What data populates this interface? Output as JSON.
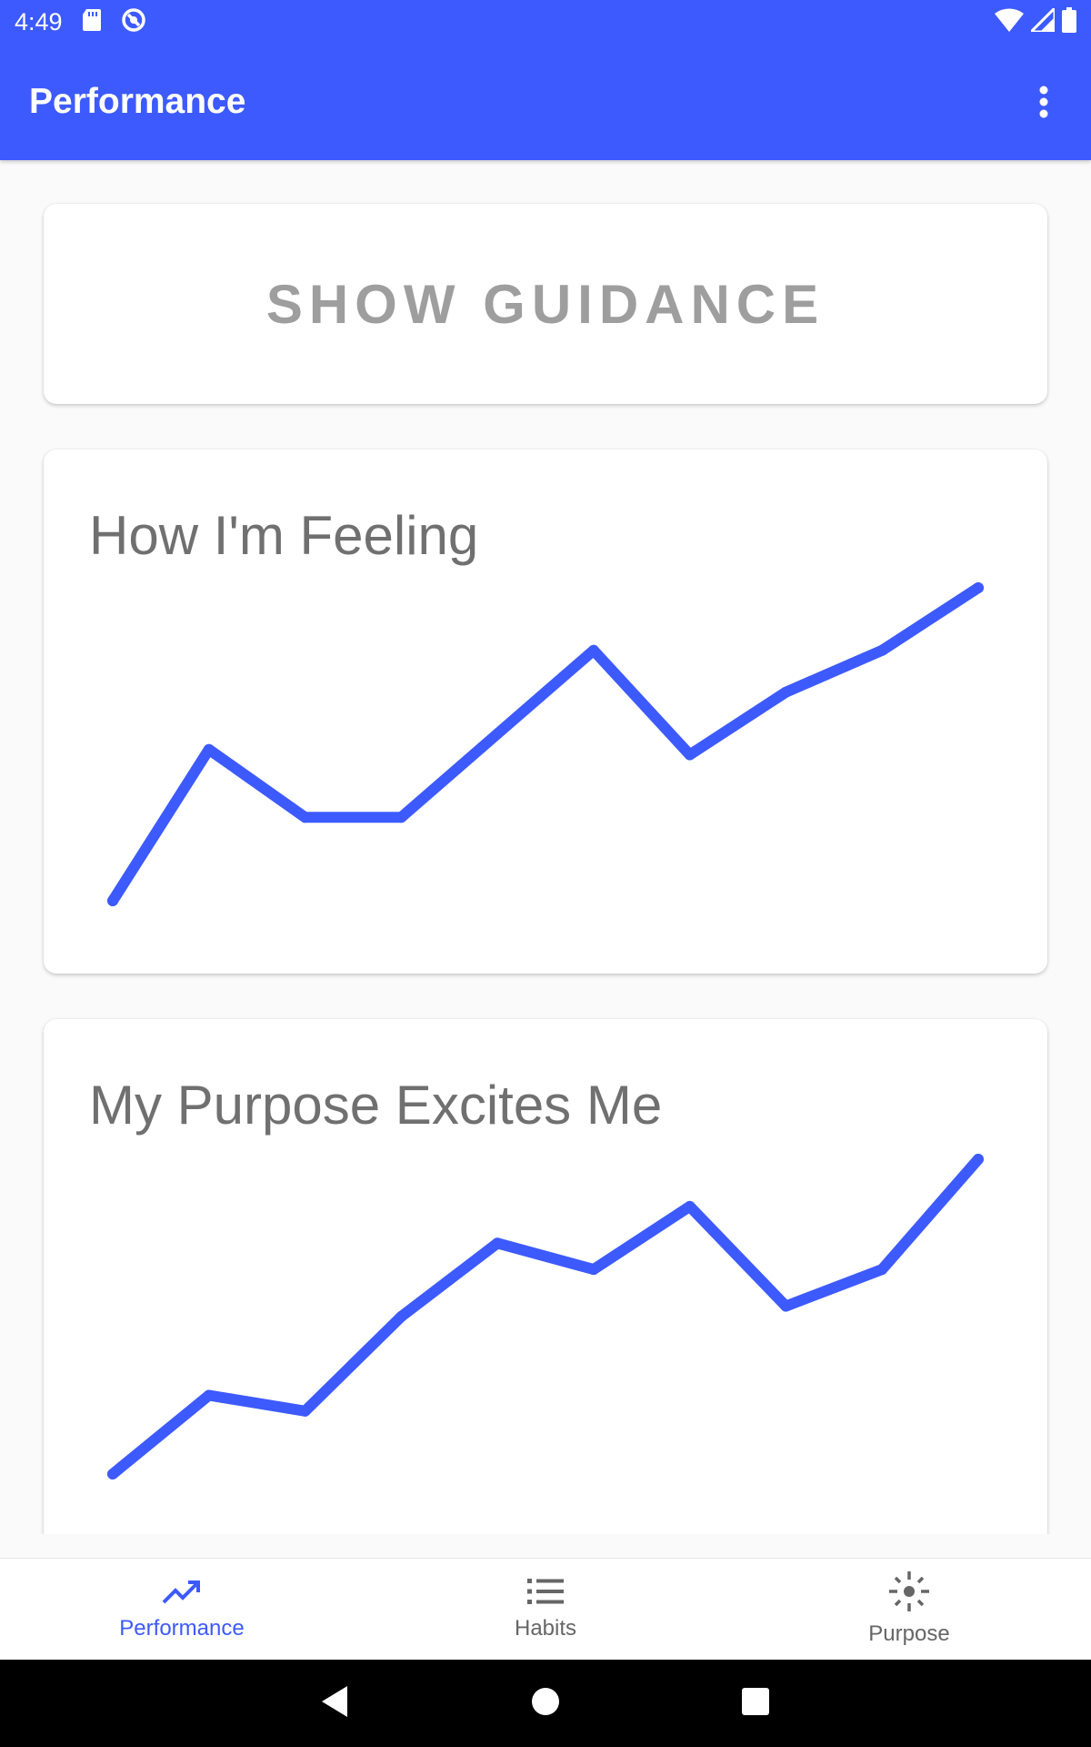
{
  "status_bar": {
    "time": "4:49",
    "icons_left": [
      "sd-card-icon",
      "data-saver-icon"
    ],
    "icons_right": [
      "wifi-icon",
      "cellular-signal-icon",
      "battery-icon"
    ]
  },
  "app_bar": {
    "title": "Performance",
    "overflow_icon": "more-vert-icon"
  },
  "guidance_button": {
    "label": "SHOW GUIDANCE"
  },
  "colors": {
    "primary": "#3d5afe",
    "line": "#3d5afe",
    "text_muted": "#707070",
    "button_text": "#9e9e9e"
  },
  "chart_data": [
    {
      "type": "line",
      "title": "How I'm Feeling",
      "x": [
        1,
        2,
        3,
        4,
        5,
        6,
        7,
        8,
        9,
        10
      ],
      "values": [
        1.0,
        3.9,
        2.6,
        2.6,
        4.2,
        5.8,
        3.8,
        5.0,
        5.8,
        7.0
      ],
      "ylim": [
        0,
        7
      ],
      "grid": false
    },
    {
      "type": "line",
      "title": "My Purpose Excites Me",
      "x": [
        1,
        2,
        3,
        4,
        5,
        6,
        7,
        8,
        9,
        10
      ],
      "values": [
        1.0,
        2.5,
        2.2,
        4.0,
        5.4,
        4.9,
        6.1,
        4.2,
        4.9,
        7.0
      ],
      "ylim": [
        0,
        7
      ],
      "grid": false
    }
  ],
  "bottom_nav": {
    "items": [
      {
        "label": "Performance",
        "icon": "trending-up-icon",
        "active": true
      },
      {
        "label": "Habits",
        "icon": "list-icon",
        "active": false
      },
      {
        "label": "Purpose",
        "icon": "sparkle-icon",
        "active": false
      }
    ]
  },
  "system_nav": [
    "back-icon",
    "home-icon",
    "recents-icon"
  ]
}
